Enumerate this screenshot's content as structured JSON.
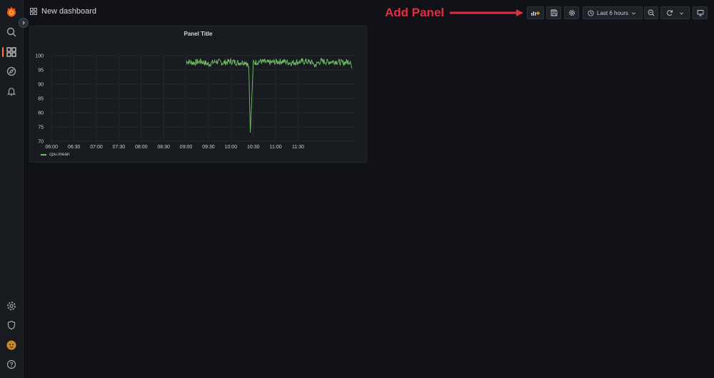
{
  "header": {
    "dashboard_title": "New dashboard",
    "time_range": "Last 6 hours"
  },
  "annotation": {
    "text": "Add Panel"
  },
  "toolbar": {
    "buttons": [
      "add-panel-icon",
      "save-icon",
      "settings-icon",
      "clock-icon",
      "zoom-out-icon",
      "refresh-icon",
      "tv-mode-icon"
    ]
  },
  "sidebar": {
    "icons": [
      "grafana-logo",
      "search-icon",
      "dashboards-icon",
      "explore-icon",
      "alerting-icon",
      "configuration-icon",
      "shield-icon",
      "user-avatar",
      "help-icon"
    ],
    "active": "dashboards-icon"
  },
  "panel": {
    "title": "Panel Title",
    "legend": "cpu.mean"
  },
  "colors": {
    "background": "#111217",
    "panel": "#181b1f",
    "series": "#73bf69",
    "annotation": "#e02f44",
    "accent": "#ff7b2e"
  },
  "chart_data": {
    "type": "line",
    "title": "Panel Title",
    "xlabel": "",
    "ylabel": "",
    "x_ticks": [
      "06:00",
      "06:30",
      "07:00",
      "07:30",
      "08:00",
      "08:30",
      "09:00",
      "09:30",
      "10:00",
      "10:30",
      "11:00",
      "11:30"
    ],
    "y_ticks": [
      100,
      95,
      90,
      85,
      80,
      75,
      70
    ],
    "ylim": [
      70,
      100
    ],
    "xlim_minutes": [
      355,
      765
    ],
    "grid": true,
    "legend_position": "bottom-left",
    "series": [
      {
        "name": "cpu.mean",
        "color": "#73bf69",
        "x_minutes": [
          540,
          550,
          560,
          570,
          580,
          590,
          600,
          610,
          620,
          624,
          626,
          628,
          630,
          640,
          650,
          660,
          670,
          680,
          690,
          700,
          710,
          712,
          720,
          730,
          740,
          750,
          760,
          762
        ],
        "values": [
          98,
          97.5,
          98,
          97,
          98,
          97.5,
          98,
          97.5,
          97.8,
          96,
          73,
          85,
          97.5,
          98,
          97.5,
          97.8,
          98,
          97.5,
          97.8,
          98,
          97.5,
          96.5,
          98,
          97.8,
          98,
          97.5,
          98,
          95.5
        ]
      }
    ]
  }
}
